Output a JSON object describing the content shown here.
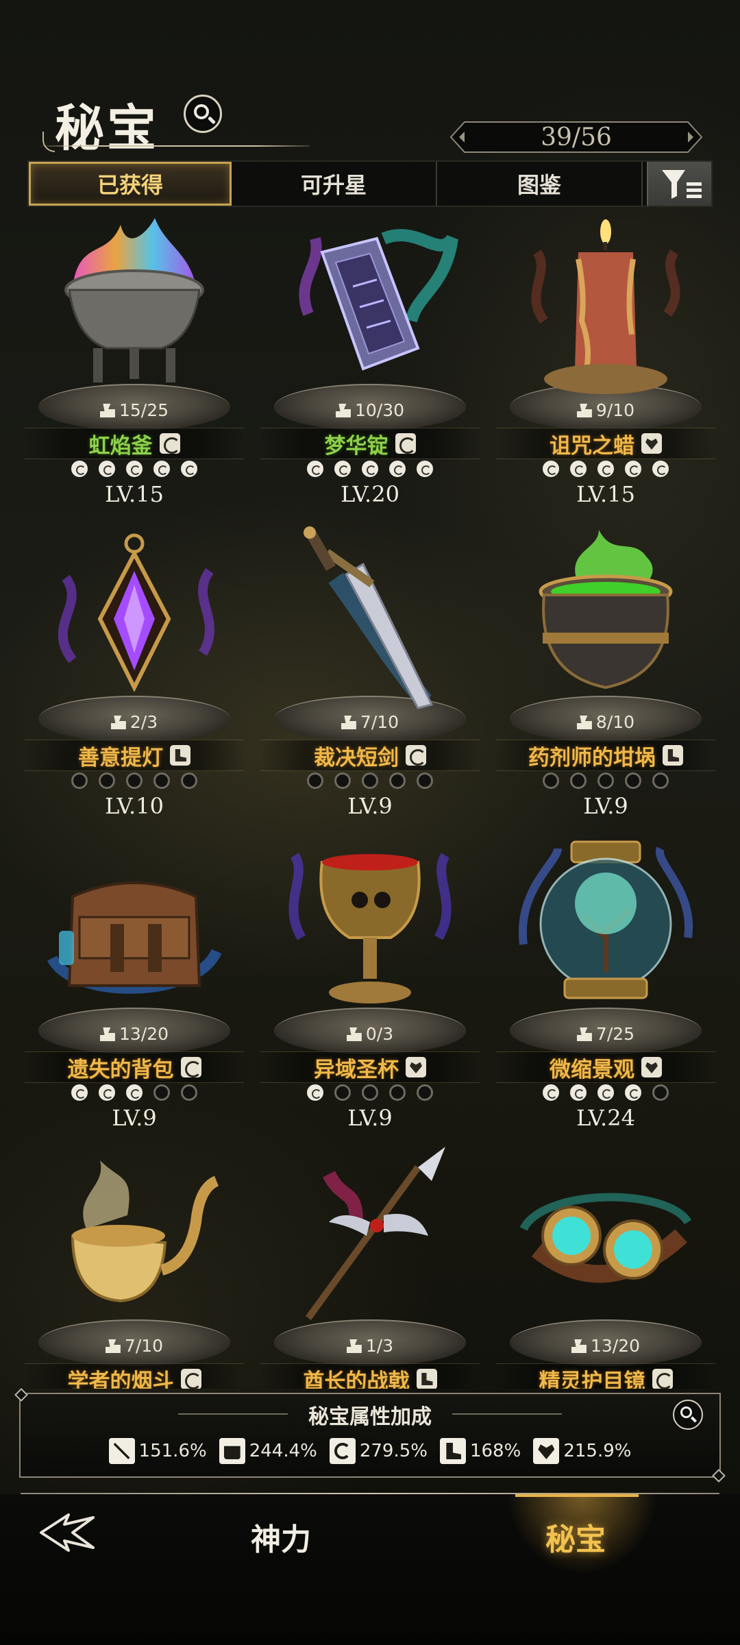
{
  "header": {
    "title": "秘宝",
    "count": "39/56"
  },
  "tabs": [
    "已获得",
    "可升星",
    "图鉴"
  ],
  "items": [
    {
      "name": "虹焰釜",
      "fragments": "15/25",
      "level": "LV.15",
      "stars": 5,
      "name_color": "green",
      "attr_icon": "spiral-icon"
    },
    {
      "name": "梦华锭",
      "fragments": "10/30",
      "level": "LV.20",
      "stars": 5,
      "name_color": "green",
      "attr_icon": "spiral-icon"
    },
    {
      "name": "诅咒之蜡",
      "fragments": "9/10",
      "level": "LV.15",
      "stars": 5,
      "name_color": "gold",
      "attr_icon": "heart-icon"
    },
    {
      "name": "善意提灯",
      "fragments": "2/3",
      "level": "LV.10",
      "stars": 5,
      "name_color": "gold",
      "attr_icon": "boot-icon"
    },
    {
      "name": "裁决短剑",
      "fragments": "7/10",
      "level": "LV.9",
      "stars": 5,
      "name_color": "gold",
      "attr_icon": "spiral-icon"
    },
    {
      "name": "药剂师的坩埚",
      "fragments": "8/10",
      "level": "LV.9",
      "stars": 5,
      "name_color": "gold",
      "attr_icon": "boot-icon"
    },
    {
      "name": "遗失的背包",
      "fragments": "13/20",
      "level": "LV.9",
      "stars": 5,
      "name_color": "gold",
      "attr_icon": "spiral-icon"
    },
    {
      "name": "异域圣杯",
      "fragments": "0/3",
      "level": "LV.9",
      "stars": 5,
      "name_color": "gold",
      "attr_icon": "heart-icon"
    },
    {
      "name": "微缩景观",
      "fragments": "7/25",
      "level": "LV.24",
      "stars": 5,
      "name_color": "gold",
      "attr_icon": "heart-icon"
    },
    {
      "name": "学者的烟斗",
      "fragments": "7/10",
      "level": "",
      "stars": 0,
      "name_color": "gold",
      "attr_icon": "spiral-icon"
    },
    {
      "name": "酋长的战戟",
      "fragments": "1/3",
      "level": "",
      "stars": 0,
      "name_color": "gold",
      "attr_icon": "boot-icon"
    },
    {
      "name": "精灵护目镜",
      "fragments": "13/20",
      "level": "",
      "stars": 0,
      "name_color": "gold",
      "attr_icon": "spiral-icon"
    }
  ],
  "star_fills": [
    5,
    5,
    5,
    0,
    0,
    0,
    3,
    1,
    4,
    0,
    0,
    0
  ],
  "bonus": {
    "title": "秘宝属性加成",
    "stats": [
      {
        "icon": "sword-icon",
        "value": "151.6%"
      },
      {
        "icon": "fist-icon",
        "value": "244.4%"
      },
      {
        "icon": "spiral-icon",
        "value": "279.5%"
      },
      {
        "icon": "boot-icon",
        "value": "168%"
      },
      {
        "icon": "heart-icon",
        "value": "215.9%"
      }
    ]
  },
  "nav": {
    "tab1": "神力",
    "tab2": "秘宝"
  },
  "colors": {
    "accent_gold": "#f2c24f",
    "name_green": "#8fd14a",
    "name_gold": "#f0b84a"
  }
}
